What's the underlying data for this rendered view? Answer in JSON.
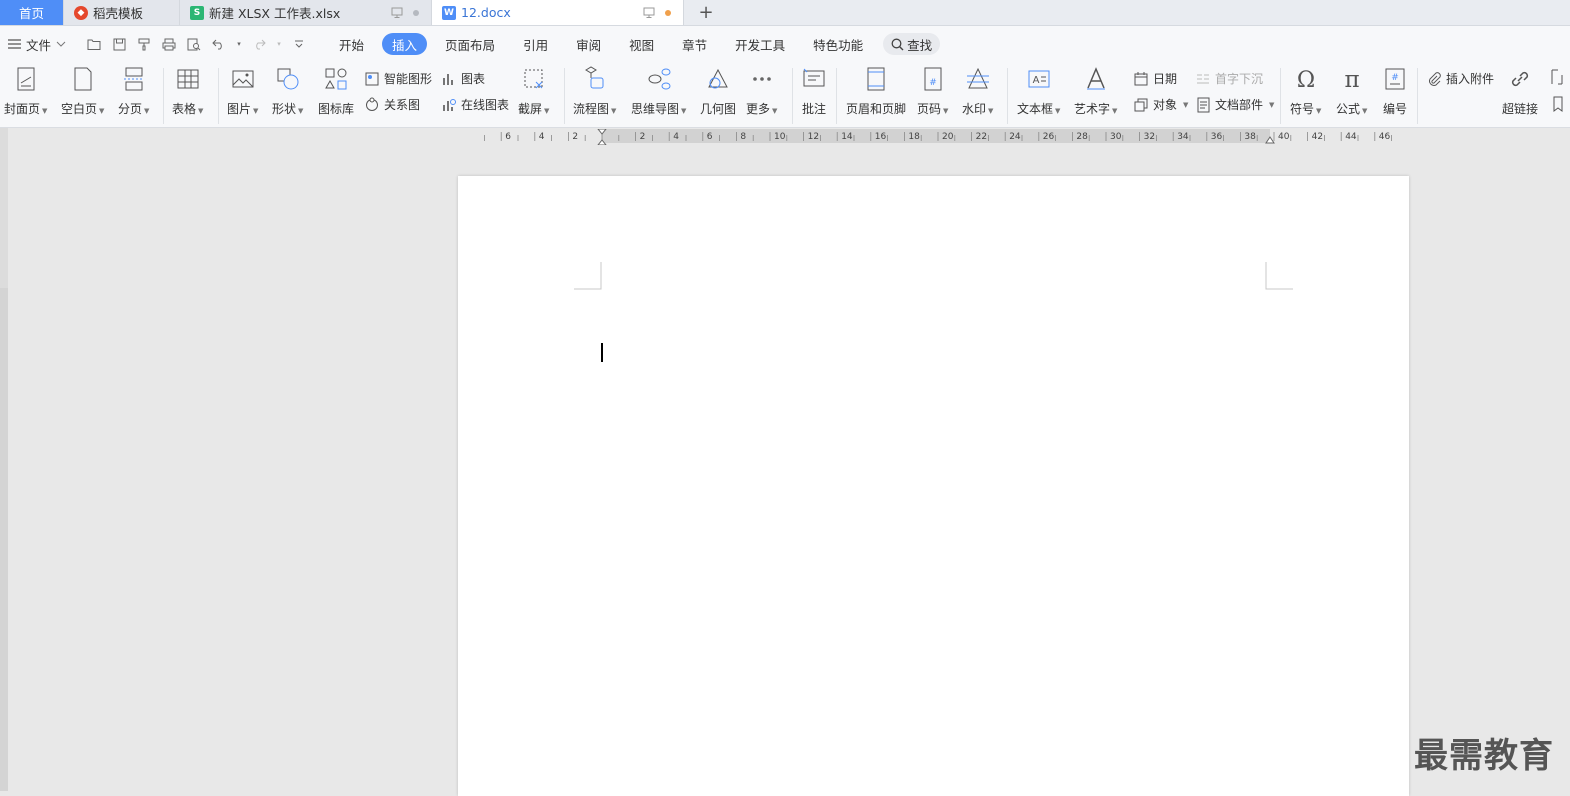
{
  "tabs": {
    "home": "首页",
    "template": "稻壳模板",
    "xlsx": "新建 XLSX 工作表.xlsx",
    "docx": "12.docx",
    "new_tab": "+"
  },
  "menu": {
    "file": "文件",
    "tabs": [
      "开始",
      "插入",
      "页面布局",
      "引用",
      "审阅",
      "视图",
      "章节",
      "开发工具",
      "特色功能"
    ],
    "search": "查找"
  },
  "ribbon": {
    "cover": "封面页",
    "blank": "空白页",
    "pagebreak": "分页",
    "table": "表格",
    "picture": "图片",
    "shape": "形状",
    "iconlib": "图标库",
    "smartart": "智能图形",
    "chart": "图表",
    "relation": "关系图",
    "onlinechart": "在线图表",
    "screenshot": "截屏",
    "flowchart": "流程图",
    "mindmap": "思维导图",
    "geometry": "几何图",
    "more": "更多",
    "comment": "批注",
    "headerfooter": "页眉和页脚",
    "pagenum": "页码",
    "watermark": "水印",
    "textbox": "文本框",
    "wordart": "艺术字",
    "date": "日期",
    "object": "对象",
    "dropcap": "首字下沉",
    "docpart": "文档部件",
    "symbol": "符号",
    "formula": "公式",
    "numbering": "编号",
    "attachment": "插入附件",
    "hyperlink": "超链接"
  },
  "ruler": {
    "labels": [
      "6",
      "4",
      "2",
      "2",
      "4",
      "6",
      "8",
      "10",
      "12",
      "14",
      "16",
      "18",
      "20",
      "22",
      "24",
      "26",
      "28",
      "30",
      "32",
      "34",
      "36",
      "38",
      "40",
      "42",
      "44",
      "46"
    ]
  },
  "watermark_text": "最需教育",
  "colors": {
    "accent": "#4f8ef7",
    "active_tab_text": "#3a75d6"
  }
}
